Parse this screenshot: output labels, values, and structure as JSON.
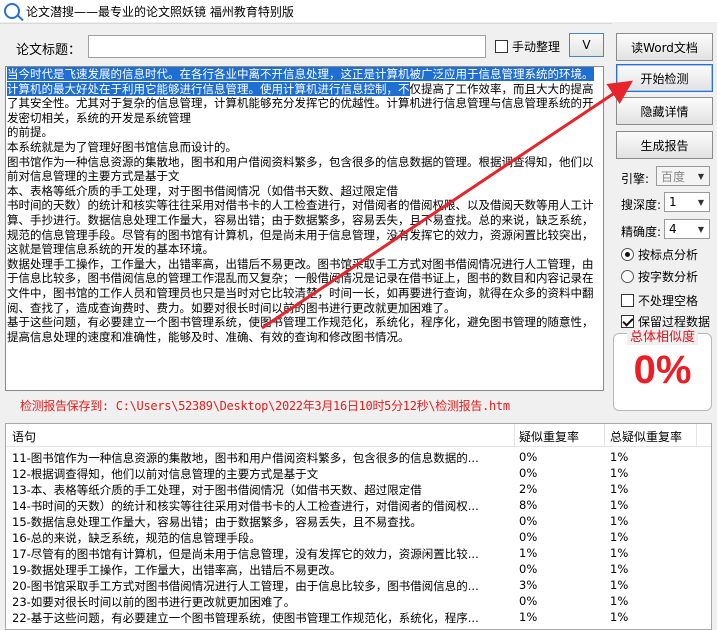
{
  "window": {
    "title": "论文潜搜——最专业的论文照妖镜 福州教育特别版"
  },
  "header": {
    "title_label": "论文标题：",
    "title_value": "",
    "manual_tidy_label": "手动整理",
    "manual_tidy_checked": false,
    "v_button": "V"
  },
  "editor": {
    "highlighted": "当今时代是飞速发展的信息时代。在各行各业中离不开信息处理，这正是计算机被广泛应用于信息管理系统的环境。计算机的最大好处在于利用它能够进行信息管理。使用计算机进行信息控制，不",
    "rest": "仅提高了工作效率，而且大大的提高了其安全性。尤其对于复杂的信息管理，计算机能够充分发挥它的优越性。计算机进行信息管理与信息管理系统的开发密切相关，系统的开发是系统管理\n的前提。\n本系统就是为了管理好图书馆信息而设计的。\n图书馆作为一种信息资源的集散地，图书和用户借阅资料繁多，包含很多的信息数据的管理。根据调查得知，他们以前对信息管理的主要方式是基于文\n本、表格等纸介质的手工处理，对于图书借阅情况（如借书天数、超过限定借\n书时间的天数）的统计和核实等往往采用对借书卡的人工检查进行，对借阅者的借阅权限、以及借阅天数等用人工计算、手抄进行。数据信息处理工作量大，容易出错；由于数据繁多，容易丢失，且不易查找。总的来说，缺乏系统，规范的信息管理手段。尽管有的图书馆有计算机，但是尚未用于信息管理，没有发挥它的效力，资源闲置比较突出，这就是管理信息系统的开发的基本环境。\n数据处理手工操作，工作量大，出错率高，出错后不易更改。图书馆采取手工方式对图书借阅情况进行人工管理，由于信息比较多，图书借阅信息的管理工作混乱而又复杂；一般借阅情况是记录在借书证上，图书的数目和内容记录在文件中，图书馆的工作人员和管理员也只是当时对它比较清楚，时间一长，如再要进行查询，就得在众多的资料中翻阅、查找了，造成查询费时、费力。如要对很长时间以前的图书进行更改就更加困难了。\n基于这些问题，有必要建立一个图书管理系统，使图书管理工作规范化，系统化，程序化，避免图书管理的随意性，提高信息处理的速度和准确性，能够及时、准确、有效的查询和修改图书情况。"
  },
  "sidebar": {
    "read_word": "读Word文档",
    "start_check": "开始检测",
    "hide_details": "隐藏详情",
    "generate_report": "生成报告",
    "engine_label": "引擎:",
    "engine_value": "百度",
    "depth_label": "搜深度:",
    "depth_value": "1",
    "precision_label": "精确度:",
    "precision_value": "4",
    "radio_sentence": "按标点分析",
    "radio_char": "按字数分析",
    "selected_radio": "sentence",
    "no_space_label": "不处理空格",
    "no_space_checked": false,
    "keep_process_label": "保留过程数据",
    "keep_process_checked": true,
    "similarity_title": "总体相似度",
    "similarity_value": "0%"
  },
  "report": {
    "label": "检测报告保存到:",
    "path": "C:\\Users\\52389\\Desktop\\2022年3月16日10时5分12秒\\检测报告.htm"
  },
  "table": {
    "headers": [
      "语句",
      "疑似重复率",
      "总疑似重复率"
    ],
    "rows": [
      [
        "11-图书馆作为一种信息资源的集散地，图书和用户借阅资料繁多，包含很多的信息数据的...",
        "0%",
        "1%"
      ],
      [
        "12-根据调查得知，他们以前对信息管理的主要方式是基于文",
        "0%",
        "1%"
      ],
      [
        "13-本、表格等纸介质的手工处理，对于图书借阅情况（如借书天数、超过限定借",
        "2%",
        "1%"
      ],
      [
        "14-书时间的天数）的统计和核实等往往采用对借书卡的人工检查进行，对借阅者的借阅权...",
        "8%",
        "1%"
      ],
      [
        "15-数据信息处理工作量大，容易出错；由于数据繁多，容易丢失，且不易查找。",
        "0%",
        "1%"
      ],
      [
        "16-总的来说，缺乏系统，规范的信息管理手段。",
        "0%",
        "1%"
      ],
      [
        "17-尽管有的图书馆有计算机，但是尚未用于信息管理，没有发挥它的效力，资源闲置比较...",
        "1%",
        "1%"
      ],
      [
        "19-数据处理手工操作，工作量大，出错率高，出错后不易更改。",
        "0%",
        "1%"
      ],
      [
        "20-图书馆采取手工方式对图书借阅情况进行人工管理，由于信息比较多，图书借阅信息的...",
        "3%",
        "1%"
      ],
      [
        "23-如要对很长时间以前的图书进行更改就更加困难了。",
        "0%",
        "1%"
      ],
      [
        "22-基于这些问题，有必要建立一个图书管理系统，使图书管理工作规范化，系统化，程序...",
        "1%",
        "1%"
      ]
    ]
  }
}
